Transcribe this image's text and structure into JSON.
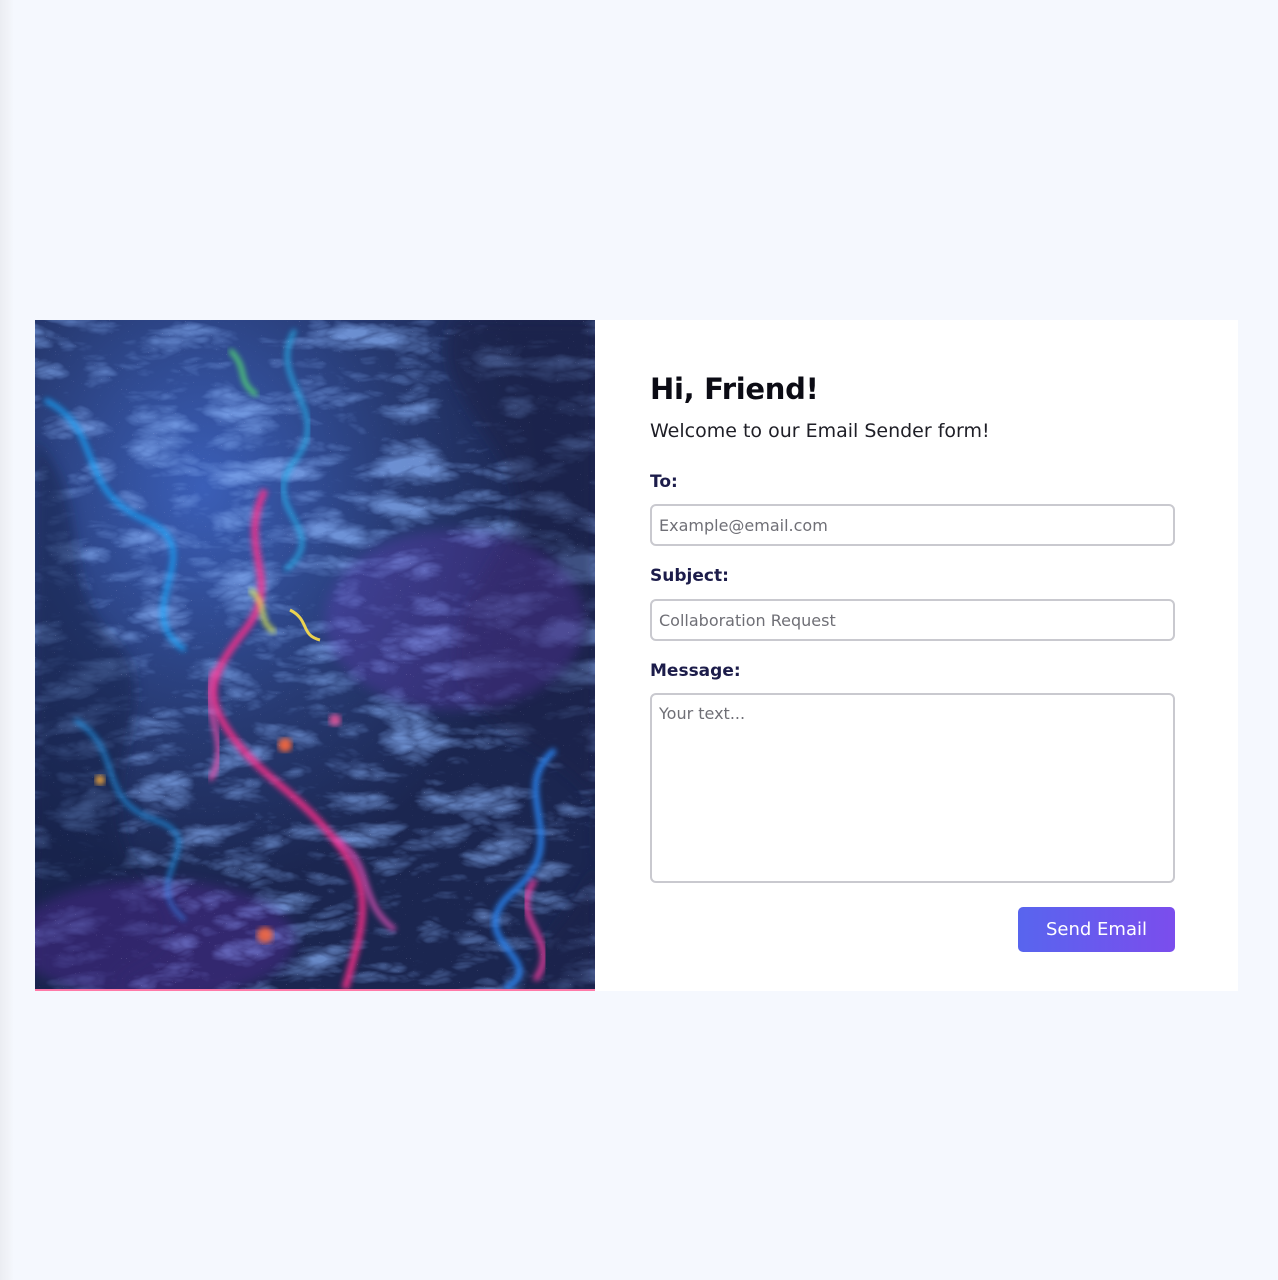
{
  "page": {
    "background_color": "#f5f8fe"
  },
  "hero_image": {
    "description_icon": "abstract-fluid-art-image",
    "colors": [
      "#2b3f78",
      "#1f6fd6",
      "#ff2f8a",
      "#19c3ff",
      "#7a3fd0",
      "#e8ff4f"
    ]
  },
  "form": {
    "greeting": "Hi, Friend!",
    "subtitle": "Welcome to our Email Sender form!",
    "to": {
      "label": "To:",
      "placeholder": "Example@email.com",
      "value": ""
    },
    "subject": {
      "label": "Subject:",
      "placeholder": "Collaboration Request",
      "value": ""
    },
    "message": {
      "label": "Message:",
      "placeholder": "Your text...",
      "value": ""
    },
    "submit_label": "Send Email",
    "accent_gradient": [
      "#5865ee",
      "#7b4ded"
    ]
  }
}
